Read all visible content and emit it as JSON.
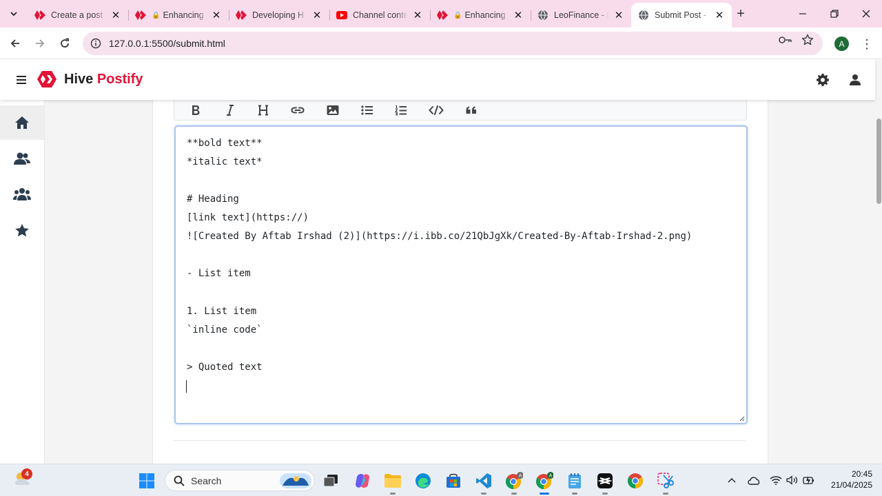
{
  "browser": {
    "tabs": [
      {
        "title": "Create a post",
        "favicon": "hive-icon",
        "locked": false
      },
      {
        "title": "Enhancing H",
        "favicon": "hive-icon",
        "locked": true
      },
      {
        "title": "Developing H",
        "favicon": "hive-icon",
        "locked": false
      },
      {
        "title": "Channel conte",
        "favicon": "youtube-icon",
        "locked": false
      },
      {
        "title": "Enhancing",
        "favicon": "hive-icon",
        "locked": true
      },
      {
        "title": "LeoFinance - I",
        "favicon": "globe-icon",
        "locked": false
      },
      {
        "title": "Submit Post -",
        "favicon": "globe-icon",
        "locked": false,
        "active": true
      }
    ],
    "url": "127.0.0.1:5500/submit.html",
    "profile_initial": "A"
  },
  "app": {
    "brand_name": "Hive",
    "brand_accent": "Postify",
    "accent_color": "#e31337"
  },
  "editor": {
    "toolbar": [
      "bold",
      "italic",
      "heading",
      "link",
      "image",
      "bulleted-list",
      "numbered-list",
      "code",
      "quote"
    ],
    "lines": [
      "**bold text**",
      "*italic text*",
      "",
      "# Heading",
      "[link text](https://)",
      "![Created By Aftab Irshad (2)](https://i.ibb.co/21QbJgXk/Created-By-Aftab-Irshad-2.png)",
      "",
      "- List item",
      "",
      "1. List item",
      "`inline code`",
      "",
      "> Quoted text"
    ]
  },
  "taskbar": {
    "search_placeholder": "Search",
    "weather_badge": "4",
    "time": "20:45",
    "date": "21/04/2025"
  }
}
